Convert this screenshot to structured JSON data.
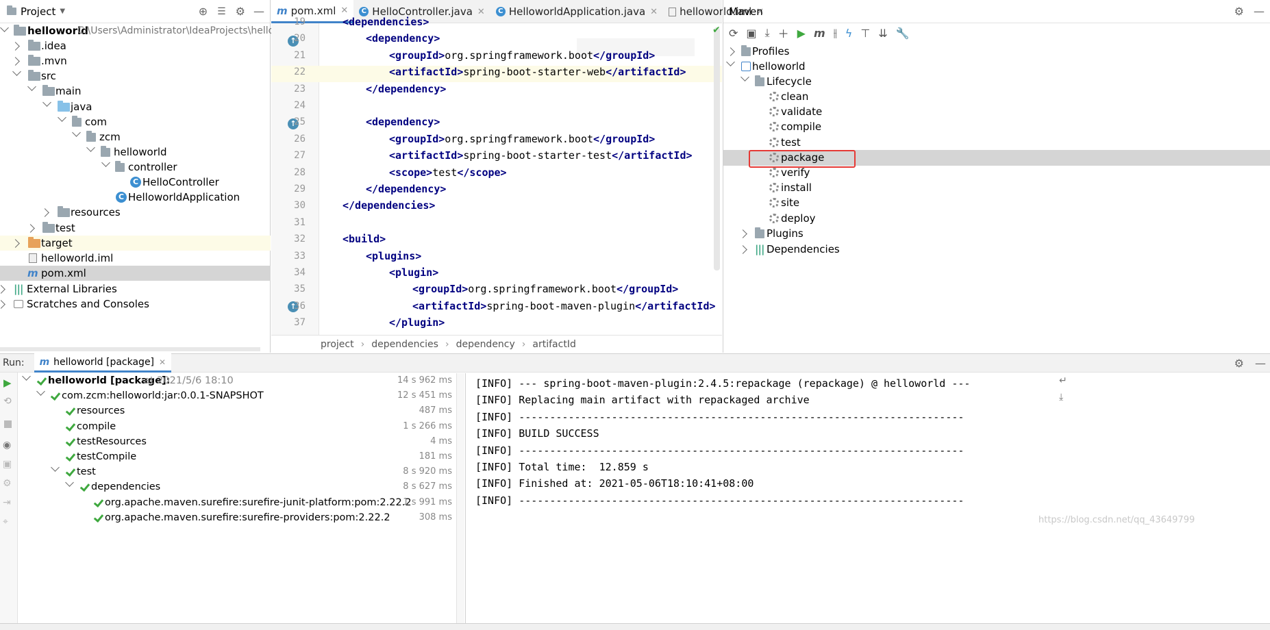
{
  "project_panel": {
    "title": "Project",
    "root_name": "helloworld",
    "root_path": "C:\\Users\\Administrator\\IdeaProjects\\hellowor",
    "items": [
      ".idea",
      ".mvn",
      "src",
      "main",
      "java",
      "com",
      "zcm",
      "helloworld",
      "controller",
      "HelloController",
      "HelloworldApplication",
      "resources",
      "test",
      "target",
      "helloworld.iml",
      "pom.xml",
      "External Libraries",
      "Scratches and Consoles"
    ]
  },
  "editor": {
    "tabs": [
      "pom.xml",
      "HelloController.java",
      "HelloworldApplication.java",
      "helloworld.iml"
    ],
    "line_numbers": [
      "19",
      "20",
      "21",
      "22",
      "23",
      "24",
      "25",
      "26",
      "27",
      "28",
      "29",
      "30",
      "31",
      "32",
      "33",
      "34",
      "35",
      "36",
      "37"
    ],
    "lines": [
      {
        "open": "<dependencies>",
        "text": "",
        "close": ""
      },
      {
        "open": "<dependency>",
        "text": "",
        "close": ""
      },
      {
        "open": "<groupId>",
        "text": "org.springframework.boot",
        "close": "</groupId>"
      },
      {
        "open": "<artifactId>",
        "text": "spring-boot-starter-web",
        "close": "</artifactId>"
      },
      {
        "open": "</dependency>",
        "text": "",
        "close": ""
      },
      {
        "open": "",
        "text": "",
        "close": ""
      },
      {
        "open": "<dependency>",
        "text": "",
        "close": ""
      },
      {
        "open": "<groupId>",
        "text": "org.springframework.boot",
        "close": "</groupId>"
      },
      {
        "open": "<artifactId>",
        "text": "spring-boot-starter-test",
        "close": "</artifactId>"
      },
      {
        "open": "<scope>",
        "text": "test",
        "close": "</scope>"
      },
      {
        "open": "</dependency>",
        "text": "",
        "close": ""
      },
      {
        "open": "</dependencies>",
        "text": "",
        "close": ""
      },
      {
        "open": "",
        "text": "",
        "close": ""
      },
      {
        "open": "<build>",
        "text": "",
        "close": ""
      },
      {
        "open": "<plugins>",
        "text": "",
        "close": ""
      },
      {
        "open": "<plugin>",
        "text": "",
        "close": ""
      },
      {
        "open": "<groupId>",
        "text": "org.springframework.boot",
        "close": "</groupId>"
      },
      {
        "open": "<artifactId>",
        "text": "spring-boot-maven-plugin",
        "close": "</artifactId>"
      },
      {
        "open": "</plugin>",
        "text": "",
        "close": ""
      }
    ],
    "breadcrumb": [
      "project",
      "dependencies",
      "dependency",
      "artifactId"
    ]
  },
  "maven": {
    "title": "Maven",
    "profiles": "Profiles",
    "project": "helloworld",
    "lifecycle": "Lifecycle",
    "phases": [
      "clean",
      "validate",
      "compile",
      "test",
      "package",
      "verify",
      "install",
      "site",
      "deploy"
    ],
    "plugins": "Plugins",
    "dependencies": "Dependencies"
  },
  "run": {
    "label": "Run:",
    "tab": "helloworld [package]",
    "tree": [
      {
        "name": "helloworld [package]:",
        "suffix": "at 2021/5/6 18:10",
        "time": "14 s 962 ms"
      },
      {
        "name": "com.zcm:helloworld:jar:0.0.1-SNAPSHOT",
        "time": "12 s 451 ms"
      },
      {
        "name": "resources",
        "time": "487 ms"
      },
      {
        "name": "compile",
        "time": "1 s 266 ms"
      },
      {
        "name": "testResources",
        "time": "4 ms"
      },
      {
        "name": "testCompile",
        "time": "181 ms"
      },
      {
        "name": "test",
        "time": "8 s 920 ms"
      },
      {
        "name": "dependencies",
        "time": "8 s 627 ms"
      },
      {
        "name": "org.apache.maven.surefire:surefire-junit-platform:pom:2.22.2",
        "time": "1 s 991 ms"
      },
      {
        "name": "org.apache.maven.surefire:surefire-providers:pom:2.22.2",
        "time": "308 ms"
      }
    ],
    "console": [
      "[INFO] --- spring-boot-maven-plugin:2.4.5:repackage (repackage) @ helloworld ---",
      "[INFO] Replacing main artifact with repackaged archive",
      "[INFO] ------------------------------------------------------------------------",
      "[INFO] BUILD SUCCESS",
      "[INFO] ------------------------------------------------------------------------",
      "[INFO] Total time:  12.859 s",
      "[INFO] Finished at: 2021-05-06T18:10:41+08:00",
      "[INFO] ------------------------------------------------------------------------"
    ],
    "watermark": "https://blog.csdn.net/qq_43649799"
  },
  "colors": {
    "highlight_box": "#e53935",
    "selection": "#d5d5d5",
    "current_line": "#fdfbe7",
    "accent": "#4083c9"
  }
}
